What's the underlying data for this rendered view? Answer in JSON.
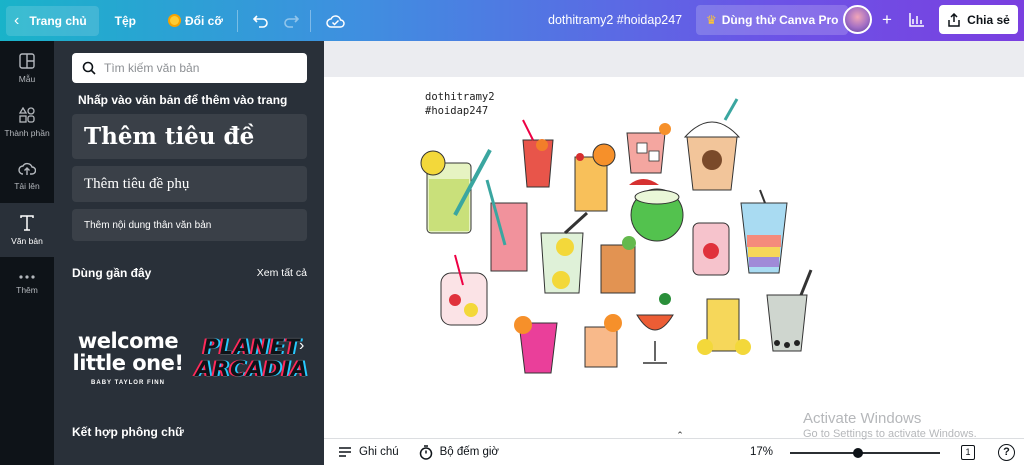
{
  "topbar": {
    "home_label": "Trang chủ",
    "file_label": "Tệp",
    "resize_label": "Đổi cỡ",
    "doc_title": "dothitramy2 #hoidap247",
    "pro_label": "Dùng thử Canva Pro",
    "share_label": "Chia sẻ"
  },
  "rail": {
    "items": [
      {
        "label": "Mẫu",
        "icon": "layout-icon"
      },
      {
        "label": "Thành phần",
        "icon": "shapes-icon"
      },
      {
        "label": "Tải lên",
        "icon": "cloud-upload-icon"
      },
      {
        "label": "Văn bản",
        "icon": "text-icon"
      },
      {
        "label": "Thêm",
        "icon": "more-dots-icon"
      }
    ]
  },
  "panel": {
    "search_placeholder": "Tìm kiếm văn bản",
    "hint": "Nhấp vào văn bản để thêm vào trang",
    "add_heading": "Thêm tiêu đề",
    "add_subheading": "Thêm tiêu đề phụ",
    "add_body": "Thêm nội dung thân văn bản",
    "recent_title": "Dùng gần đây",
    "see_all": "Xem tất cả",
    "recent_fonts": [
      {
        "line1": "welcome",
        "line2": "little one!",
        "line3": "BABY TAYLOR FINN"
      },
      {
        "line1": "PLANET",
        "line2": "ARCADIA"
      }
    ],
    "combo_title": "Kết hợp phông chữ"
  },
  "canvas": {
    "caption_line1": "dothitramy2",
    "caption_line2": "#hoidap247"
  },
  "bottombar": {
    "notes_label": "Ghi chú",
    "timer_label": "Bộ đếm giờ",
    "zoom": "17%",
    "zoom_fraction": 0.45,
    "page_count": "1",
    "help": "?"
  },
  "watermark": {
    "line1": "Activate Windows",
    "line2": "Go to Settings to activate Windows."
  }
}
